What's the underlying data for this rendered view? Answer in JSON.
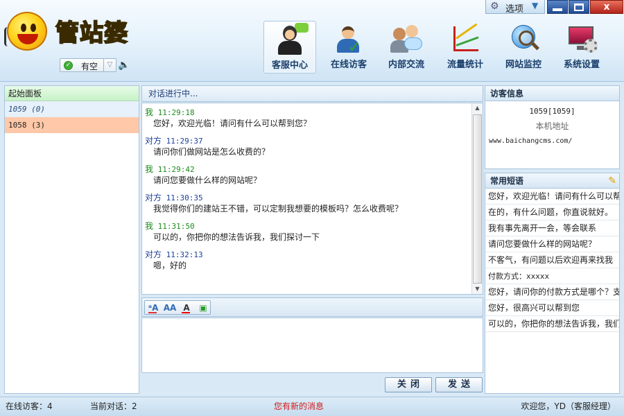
{
  "app": {
    "logo_text": "管站婆"
  },
  "window": {
    "options_label": "选项",
    "close_glyph": "x"
  },
  "status": {
    "label": "有空"
  },
  "nav": [
    {
      "label": "客服中心",
      "icon": "customer-service-icon",
      "active": true
    },
    {
      "label": "在线访客",
      "icon": "online-visitor-icon",
      "active": false
    },
    {
      "label": "内部交流",
      "icon": "internal-chat-icon",
      "active": false
    },
    {
      "label": "流量统计",
      "icon": "traffic-stats-icon",
      "active": false
    },
    {
      "label": "网站监控",
      "icon": "site-monitor-icon",
      "active": false
    },
    {
      "label": "系统设置",
      "icon": "system-settings-icon",
      "active": false
    }
  ],
  "sessions_panel": {
    "title": "起始面板",
    "items": [
      {
        "label": "1059 (0)",
        "state": "idle"
      },
      {
        "label": "1058 (3)",
        "state": "selected"
      }
    ]
  },
  "chat": {
    "header": "对话进行中...",
    "messages": [
      {
        "sender": "我",
        "time": "11:29:18",
        "text": "您好，欢迎光临！请问有什么可以帮到您？",
        "side": "self"
      },
      {
        "sender": "对方",
        "time": "11:29:37",
        "text": "请问你们做网站是怎么收费的？",
        "side": "other"
      },
      {
        "sender": "我",
        "time": "11:29:42",
        "text": "请问您要做什么样的网站呢？",
        "side": "self"
      },
      {
        "sender": "对方",
        "time": "11:30:35",
        "text": "我觉得你们的建站王不错，可以定制我想要的模板吗？怎么收费呢？",
        "side": "other"
      },
      {
        "sender": "我",
        "time": "11:31:50",
        "text": "可以的，你把你的想法告诉我，我们探讨一下",
        "side": "self"
      },
      {
        "sender": "对方",
        "time": "11:32:13",
        "text": " 嗯，好的",
        "side": "other"
      }
    ],
    "close_label": "关闭",
    "send_label": "发送"
  },
  "visitor_info": {
    "title": "访客信息",
    "id": "1059[1059]",
    "location": "本机地址",
    "url": "www.baichangcms.com/"
  },
  "phrases": {
    "title": "常用短语",
    "items": [
      "您好，欢迎光临！请问有什么可以帮",
      "在的，有什么问题，你直说就好。",
      "我有事先离开一会，等会联系",
      "请问您要做什么样的网站呢？",
      "不客气，有问题以后欢迎再来找我",
      "付款方式：xxxxx",
      "您好，请问你的付款方式是哪个？支",
      "您好，很高兴可以帮到您",
      "可以的，你把你的想法告诉我，我们"
    ]
  },
  "statusbar": {
    "online_visitors": "在线访客：4",
    "current_sessions": "当前对话：2",
    "notice": "您有新的消息",
    "welcome": "欢迎您，YD（客服经理）"
  },
  "colors": {
    "accent": "#2f6bb5",
    "self_message": "#1b8a1b",
    "other_message": "#1a3e9a",
    "notice": "#d21a1a",
    "selected_session": "#ffc8a8"
  }
}
